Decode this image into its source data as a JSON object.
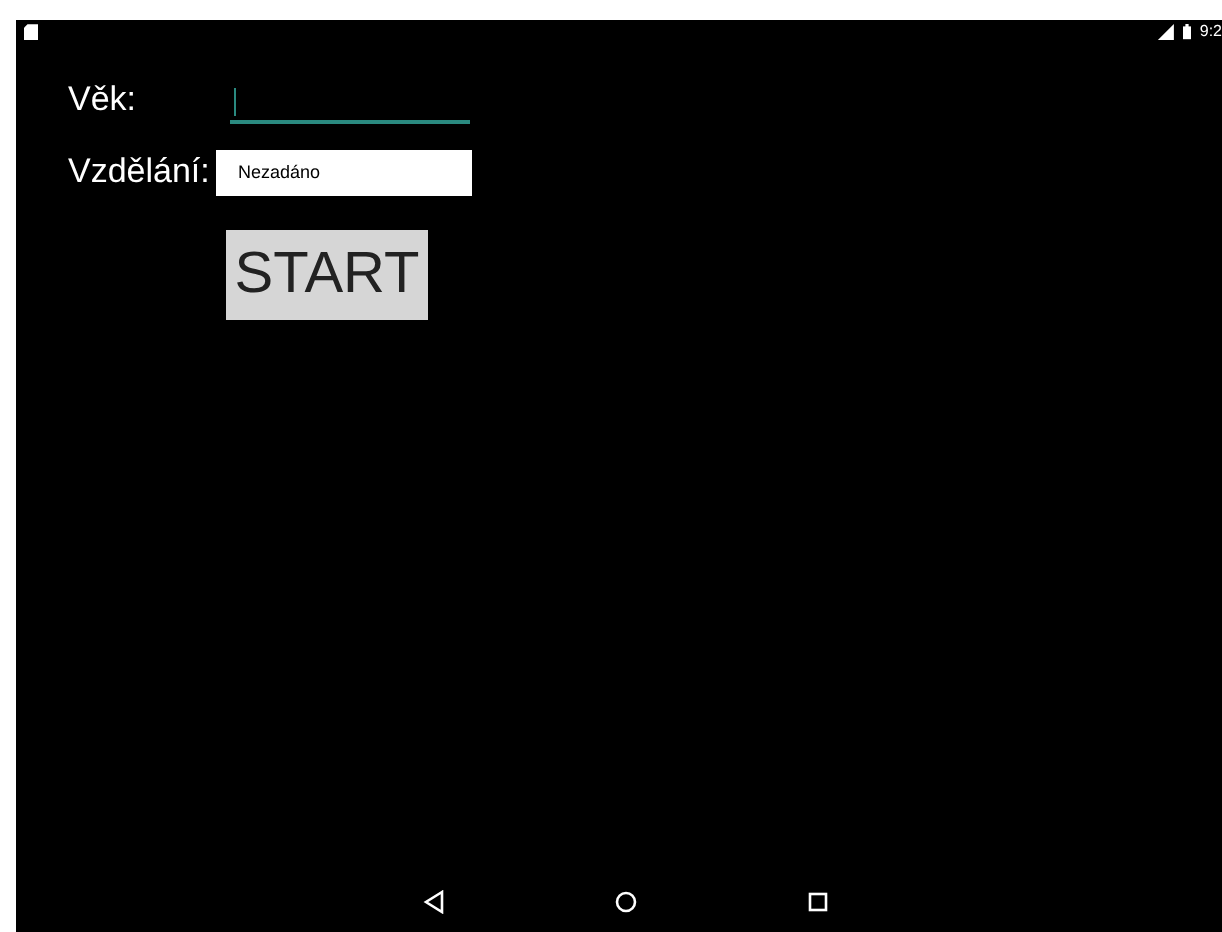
{
  "status_bar": {
    "time": "9:2"
  },
  "form": {
    "age_label": "Věk:",
    "education_label": "Vzdělání:",
    "education_value": "Nezadáno"
  },
  "start_button": "START"
}
